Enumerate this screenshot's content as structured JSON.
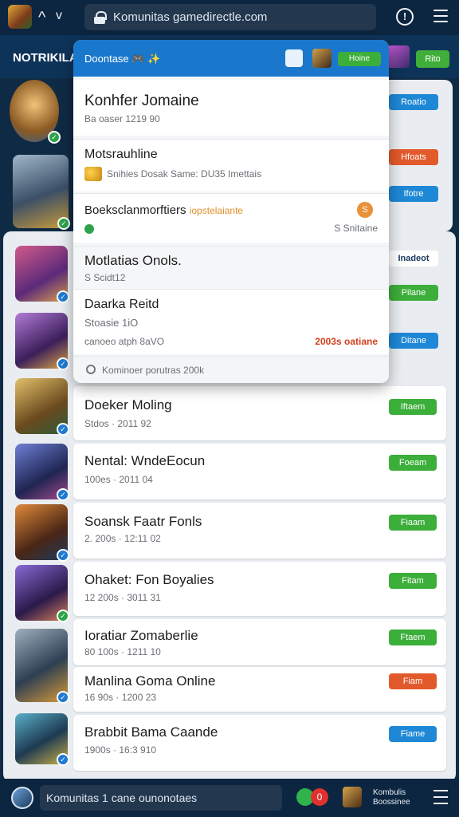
{
  "browser": {
    "url": "Komunitas gamedirectle.com",
    "back_glyph": "^",
    "forward_glyph": "v",
    "alert_glyph": "!"
  },
  "header": {
    "title": "NOTRIKILA",
    "button": "Rito"
  },
  "popup": {
    "head_title": "Doontase 🎮 ✨",
    "head_button": "Hoine",
    "section1": {
      "title": "Konhfer Jomaine",
      "meta": "Ba oaser 1219 90"
    },
    "section2": {
      "title": "Motsrauhline",
      "meta": "Snihies Dosak Same: DU35 Imettais"
    },
    "section3": {
      "title": "Boeksclanmorftiers",
      "highlight": "iopstelaiante",
      "meta": "S Snitaine",
      "badge": "S"
    },
    "section4": {
      "title": "Motlatias Onols.",
      "meta": "S Scidt12"
    },
    "section5": {
      "title": "Daarka Reitd",
      "meta1": "Stoasie 1iO",
      "meta2": "canoeo atph 8aVO",
      "stat": "2003s oatiane"
    },
    "search_hint": "Kominoer porutras 200k"
  },
  "edge_buttons": [
    {
      "label": "Roatio",
      "color": "b"
    },
    {
      "label": "Hfoats",
      "color": "o"
    },
    {
      "label": "Ifotre",
      "color": "b"
    },
    {
      "label": "Inadeot",
      "color": "w"
    },
    {
      "label": "Pilane",
      "color": "g"
    },
    {
      "label": "Ditane",
      "color": "b"
    }
  ],
  "rows": [
    {
      "title": "Doeker Moling",
      "meta": "Stdos · 2011 92",
      "button": "Iftaem",
      "color": "g"
    },
    {
      "title": "Nental: WndeEocun",
      "meta": "100es · 2011 04",
      "button": "Foeam",
      "color": "g"
    },
    {
      "title": "Soansk Faatr Fonls",
      "meta": "2. 200s · 12:11 02",
      "button": "Fiaam",
      "color": "g"
    },
    {
      "title": "Ohaket: Fon Boyalies",
      "meta": "12 200s · 3011 31",
      "button": "Fitam",
      "color": "g"
    },
    {
      "title": "Ioratiar Zomaberlie",
      "meta": "80 100s · 1211 10",
      "button": "Ftaem",
      "color": "g"
    },
    {
      "title": "Manlina Goma Online",
      "meta": "16 90s · 1200 23",
      "button": "Fiam",
      "color": "o"
    },
    {
      "title": "Brabbit Bama Caande",
      "meta": "1900s · 16:3 910",
      "button": "Fiame",
      "color": "b"
    }
  ],
  "bottom": {
    "field": "Komunitas 1 cane ounonotaes",
    "badge": "0",
    "label": "Kombulis Boossinee"
  }
}
